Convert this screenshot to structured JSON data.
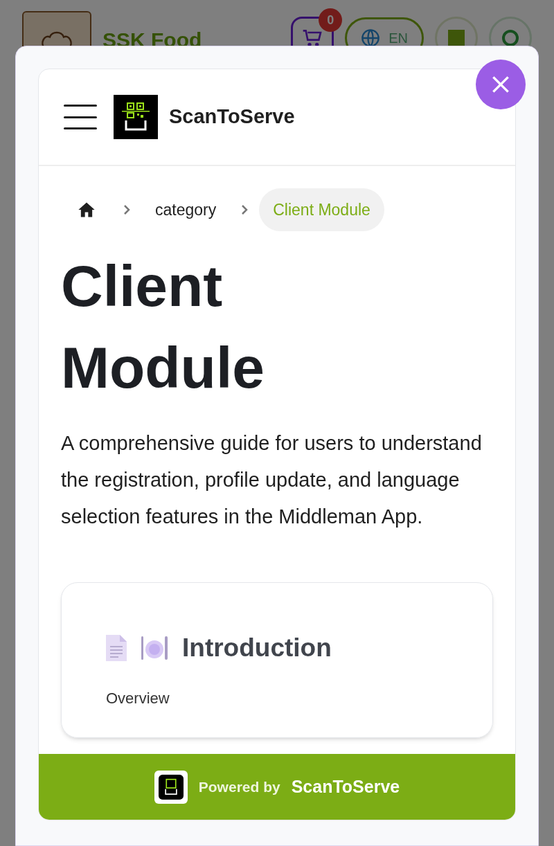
{
  "background_header": {
    "store_name": "SSK Food",
    "cart_count": "0",
    "language": "EN"
  },
  "modal": {
    "app_name": "ScanToServe",
    "breadcrumb": [
      {
        "label": "category",
        "selected": false
      },
      {
        "label": "Client Module",
        "selected": true
      }
    ],
    "title": "Client Module",
    "description": "A comprehensive guide for users to understand the registration, profile update, and language selection features in the Middleman App.",
    "section": {
      "title": "Introduction",
      "subtitle": "Overview"
    },
    "footer": {
      "prefix": "Powered by",
      "brand": "ScanToServe"
    }
  }
}
